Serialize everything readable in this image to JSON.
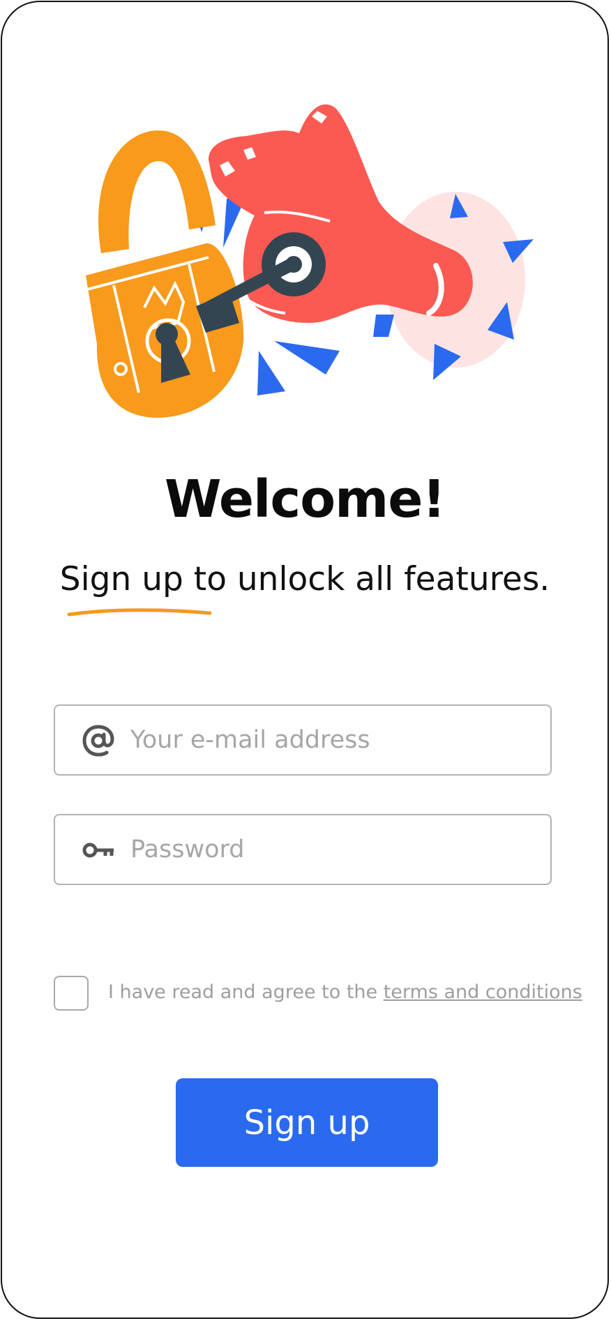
{
  "header": {
    "title": "Welcome!",
    "subtitle": "Sign up to unlock all features."
  },
  "form": {
    "email": {
      "icon": "at-icon",
      "placeholder": "Your e-mail address",
      "value": ""
    },
    "password": {
      "icon": "key-icon",
      "placeholder": "Password",
      "value": ""
    }
  },
  "terms": {
    "checked": false,
    "prefix": "I have read and agree to the ",
    "link_label": "terms and conditions"
  },
  "actions": {
    "signup_label": "Sign up"
  },
  "illustration": {
    "description_icons": [
      "padlock-icon",
      "hand-icon",
      "key-icon"
    ],
    "colors": {
      "padlock": "#f89a1c",
      "hand": "#fb5a52",
      "key": "#344552",
      "shards": "#2a6aee",
      "blob": "#fde4e3"
    }
  },
  "theme": {
    "accent": "#2a6aee",
    "underline": "#f39a1e",
    "border": "#b3b3b3",
    "placeholder": "#a6a6a6"
  }
}
